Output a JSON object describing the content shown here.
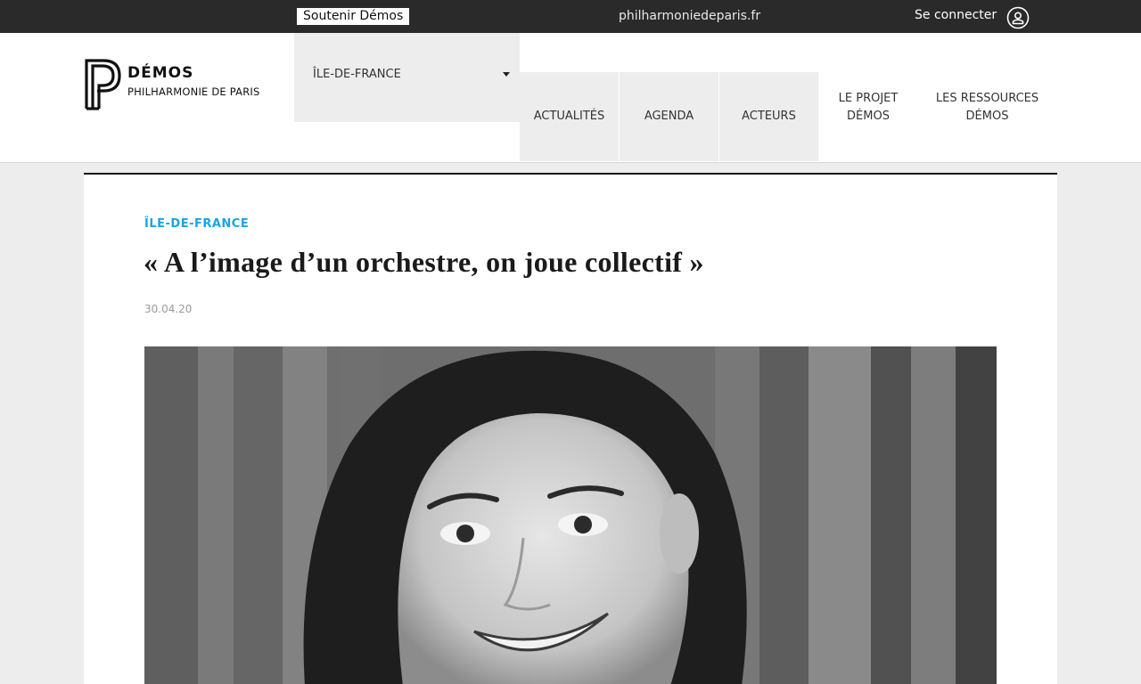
{
  "topbar": {
    "support_label": "Soutenir Démos",
    "site_link": "philharmoniedeparis.fr",
    "login_label": "Se connecter",
    "user_icon": "user-circle-icon"
  },
  "logo": {
    "title": "DÉMOS",
    "subtitle": "PHILHARMONIE DE PARIS"
  },
  "region_select": {
    "selected": "ÎLE-DE-FRANCE",
    "caret_icon": "caret-down-icon"
  },
  "nav": {
    "items": [
      {
        "label": "ACTUALITÉS"
      },
      {
        "label": "AGENDA"
      },
      {
        "label": "ACTEURS"
      },
      {
        "label_line1": "LE PROJET",
        "label_line2": "DÉMOS"
      },
      {
        "label_line1": "LES RESSOURCES",
        "label_line2": "DÉMOS"
      }
    ]
  },
  "article": {
    "category": "ÎLE-DE-FRANCE",
    "title": "« A l’image d’un orchestre, on joue collectif »",
    "date": "30.04.20"
  },
  "colors": {
    "topbar_bg": "#2a2a2a",
    "accent": "#1aa3e8",
    "page_bg": "#ededed"
  }
}
